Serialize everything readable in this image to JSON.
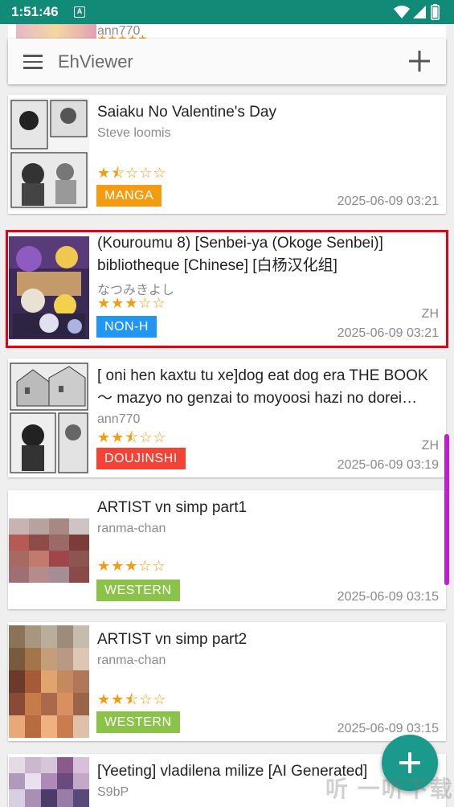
{
  "status_bar": {
    "time": "1:51:46",
    "notification_glyph": "A"
  },
  "peek_item": {
    "uploader": "ann770",
    "stars": "★★★★★"
  },
  "toolbar": {
    "title": "EhViewer"
  },
  "galleries": [
    {
      "title": "Saiaku No Valentine's Day",
      "uploader": "Steve loomis",
      "stars": "★⯪☆☆☆",
      "category": "MANGA",
      "category_color": "#f39c12",
      "language": "",
      "date": "2025-06-09 03:21"
    },
    {
      "title": "(Kouroumu 8) [Senbei-ya (Okoge Senbei)] bibliotheque [Chinese] [白杨汉化组]",
      "uploader": "なつみきよし",
      "stars": "★★★☆☆",
      "category": "NON-H",
      "category_color": "#2196f3",
      "language": "ZH",
      "date": "2025-06-09 03:21"
    },
    {
      "title": "[ oni hen kaxtu tu xe]dog eat dog era THE BOOK 〜 mazyo no genzai to moyoosi hazi no dorei kyouiku 〜 [Chinese]",
      "uploader": "ann770",
      "stars": "★★⯪☆☆",
      "category": "DOUJINSHI",
      "category_color": "#f44336",
      "language": "ZH",
      "date": "2025-06-09 03:19"
    },
    {
      "title": "ARTIST vn simp part1",
      "uploader": "ranma-chan",
      "stars": "★★★☆☆",
      "category": "WESTERN",
      "category_color": "#8bc34a",
      "language": "",
      "date": "2025-06-09 03:15"
    },
    {
      "title": "ARTIST vn simp part2",
      "uploader": "ranma-chan",
      "stars": "★★⯪☆☆",
      "category": "WESTERN",
      "category_color": "#8bc34a",
      "language": "",
      "date": "2025-06-09 03:15"
    },
    {
      "title": "[Yeeting] vladilena milize [AI Generated]",
      "uploader": "S9bP",
      "stars": "",
      "category": "",
      "category_color": "",
      "language": "",
      "date": ""
    }
  ],
  "watermark": "听 一听下载"
}
